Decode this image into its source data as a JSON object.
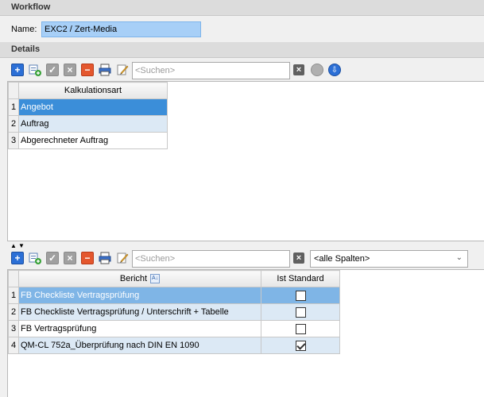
{
  "workflow": {
    "header": "Workflow",
    "name_label": "Name:",
    "name_value": "EXC2 / Zert-Media"
  },
  "details": {
    "header": "Details",
    "toolbar": {
      "search_placeholder": "<Suchen>",
      "icons": [
        "add-icon",
        "add-subrow-icon",
        "confirm-icon",
        "discard-icon",
        "delete-icon",
        "print-icon",
        "edit-icon",
        "clear-search-icon",
        "gear-icon",
        "download-icon"
      ]
    },
    "grid": {
      "column_header": "Kalkulationsart",
      "rows": [
        {
          "num": "1",
          "label": "Angebot"
        },
        {
          "num": "2",
          "label": "Auftrag"
        },
        {
          "num": "3",
          "label": "Abgerechneter Auftrag"
        }
      ]
    }
  },
  "reports": {
    "toolbar": {
      "search_placeholder": "<Suchen>",
      "column_filter": "<alle Spalten>"
    },
    "grid": {
      "col_bericht": "Bericht",
      "col_standard": "Ist Standard",
      "rows": [
        {
          "num": "1",
          "bericht": "FB Checkliste Vertragsprüfung",
          "standard": false
        },
        {
          "num": "2",
          "bericht": "FB Checkliste Vertragsprüfung / Unterschrift + Tabelle",
          "standard": false
        },
        {
          "num": "3",
          "bericht": "FB Vertragsprüfung",
          "standard": false
        },
        {
          "num": "4",
          "bericht": "QM-CL 752a_Überprüfung nach DIN EN 1090",
          "standard": true
        }
      ]
    }
  },
  "colors": {
    "selected_row": "#3b8ed9",
    "alt_row": "#dce9f5",
    "name_field": "#a7cff7"
  }
}
